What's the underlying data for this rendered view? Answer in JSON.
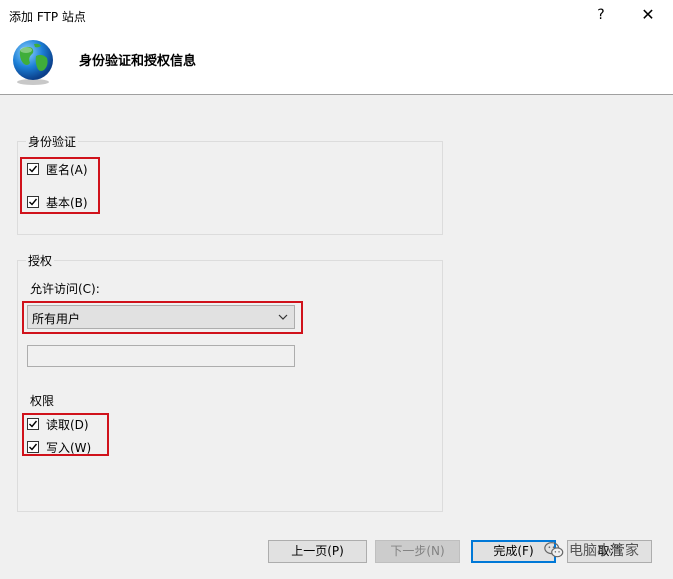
{
  "window": {
    "title": "添加 FTP 站点",
    "help_label": "?",
    "close_label": "✕"
  },
  "header": {
    "title": "身份验证和授权信息",
    "icon": "globe-icon"
  },
  "authentication": {
    "legend": "身份验证",
    "anonymous": {
      "label": "匿名(A)",
      "checked": true
    },
    "basic": {
      "label": "基本(B)",
      "checked": true
    }
  },
  "authorization": {
    "legend": "授权",
    "allow_access_label": "允许访问(C):",
    "allow_access_value": "所有用户",
    "user_input_value": "",
    "permissions_label": "权限",
    "read": {
      "label": "读取(D)",
      "checked": true
    },
    "write": {
      "label": "写入(W)",
      "checked": true
    }
  },
  "buttons": {
    "previous": "上一页(P)",
    "next": "下一步(N)",
    "finish": "完成(F)",
    "cancel": "取消"
  },
  "watermark": {
    "text": "电脑小管家",
    "icon": "wechat-icon"
  },
  "colors": {
    "highlight_red": "#d0121b",
    "dialog_bg": "#f0f0f0",
    "accent": "#0078d7"
  }
}
